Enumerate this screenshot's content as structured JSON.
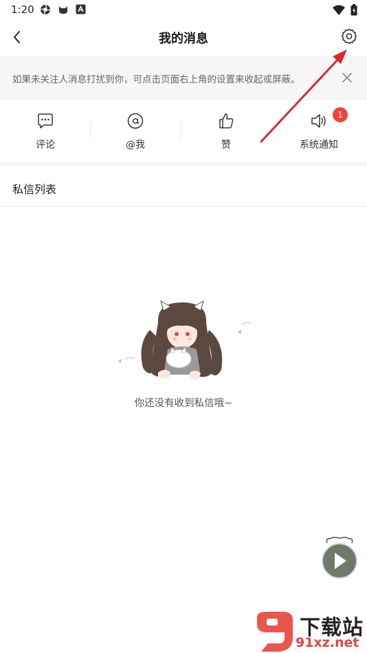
{
  "status_bar": {
    "time": "1:20"
  },
  "header": {
    "title": "我的消息",
    "back_icon": "chevron-left-icon",
    "settings_icon": "gear-icon"
  },
  "notice": {
    "text": "如果未关注人消息打扰到你，可点击页面右上角的设置来收起或屏蔽。",
    "close_icon": "close-icon"
  },
  "tabs": [
    {
      "label": "评论",
      "icon": "comment-icon"
    },
    {
      "label": "@我",
      "icon": "at-icon"
    },
    {
      "label": "赞",
      "icon": "thumbs-up-icon"
    },
    {
      "label": "系统通知",
      "icon": "speaker-icon",
      "badge": "1"
    }
  ],
  "section": {
    "title": "私信列表"
  },
  "empty_state": {
    "text": "你还没有收到私信哦~"
  },
  "watermark": {
    "main": "下载站",
    "sub": "91xz.net"
  },
  "colors": {
    "badge": "#f0433b",
    "arrow": "#e0262b",
    "notice_bg": "#f6f6f6"
  }
}
